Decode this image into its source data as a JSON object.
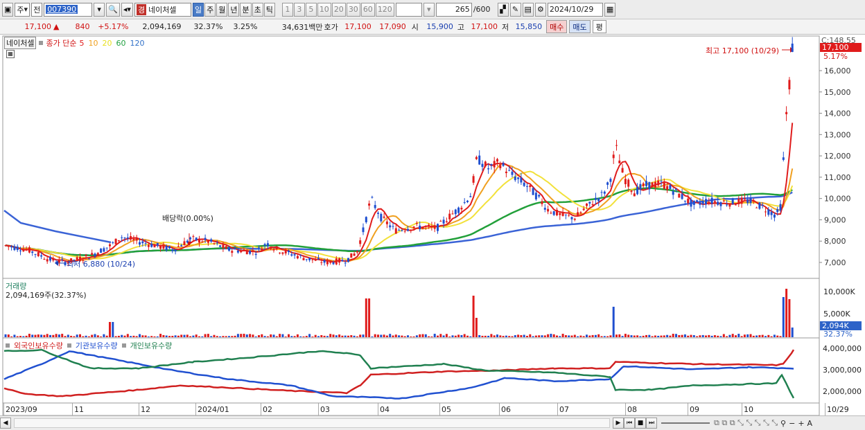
{
  "toolbar": {
    "market": "주",
    "type": "전",
    "code": "007390",
    "name_badge": "경",
    "name": "네이처셀",
    "periods": [
      "일",
      "주",
      "월",
      "년",
      "분",
      "초",
      "틱"
    ],
    "selected_period": "일",
    "intervals": [
      "1",
      "3",
      "5",
      "10",
      "20",
      "30",
      "60",
      "120"
    ],
    "count": "265",
    "count_max": "/600",
    "date": "2024/10/29"
  },
  "quote": {
    "price": "17,100",
    "arrow": "▲",
    "change": "840",
    "change_pct": "+5.17%",
    "volume": "2,094,169",
    "turnover": "32.37%",
    "ratio": "3.25%",
    "amount": "34,631백만",
    "bid_label": "호가",
    "ask": "17,100",
    "bid": "17,090",
    "open_label": "시",
    "open": "15,900",
    "high_label": "고",
    "high": "17,100",
    "low_label": "저",
    "low": "15,850",
    "buy_label": "매수",
    "sell_label": "매도",
    "eval_label": "평"
  },
  "legend": {
    "title": "네이처셀",
    "ma_label": "종가 단순",
    "ma_periods": [
      "5",
      "10",
      "20",
      "60",
      "120"
    ],
    "ma_colors": [
      "#e01c1c",
      "#f0a020",
      "#e8e020",
      "#20a040",
      "#3070c8"
    ]
  },
  "annotations": {
    "high": "최고 17,100 (10/29)",
    "low": "최저 6,880 (10/24)",
    "dividend": "배당락(0.00%)",
    "right_top": "C:148.55",
    "right_price": "17,100",
    "right_pct": "5.17%"
  },
  "volume_panel": {
    "title": "거래량",
    "value": "2,094,169주(32.37%)",
    "ticks": [
      "10,000K",
      "5,000K"
    ],
    "current": "2,094K",
    "current_pct": "32.37%"
  },
  "holding_panel": {
    "titles": [
      "외국인보유수량",
      "기관보유수량",
      "개인보유수량"
    ],
    "title_colors": [
      "#d02020",
      "#2050d0",
      "#208050"
    ],
    "ticks": [
      "4,000,000",
      "3,000,000",
      "2,000,000"
    ]
  },
  "chart_data": {
    "type": "candlestick",
    "x_axis_labels": [
      "2023/09",
      "11",
      "12",
      "2024/01",
      "02",
      "03",
      "04",
      "05",
      "06",
      "07",
      "08",
      "09",
      "10",
      "10/29"
    ],
    "y_axis_ticks": [
      "16,000",
      "15,000",
      "14,000",
      "13,000",
      "12,000",
      "11,000",
      "10,000",
      "9,000",
      "8,000",
      "7,000"
    ],
    "close_approx": [
      {
        "date": "2023/09",
        "close": 7800
      },
      {
        "date": "2023/10",
        "close": 7100
      },
      {
        "date": "2023/11",
        "close": 8100
      },
      {
        "date": "2023/12",
        "close": 7800
      },
      {
        "date": "2024/01",
        "close": 8100
      },
      {
        "date": "2024/02",
        "close": 7600
      },
      {
        "date": "2024/03",
        "close": 7000
      },
      {
        "date": "2024/04",
        "close": 8600
      },
      {
        "date": "2024/05",
        "close": 8900
      },
      {
        "date": "2024/06",
        "close": 11500
      },
      {
        "date": "2024/07",
        "close": 9200
      },
      {
        "date": "2024/08",
        "close": 10600
      },
      {
        "date": "2024/09",
        "close": 9800
      },
      {
        "date": "2024/10",
        "close": 9300
      },
      {
        "date": "2024/10/29",
        "close": 17100
      }
    ]
  },
  "bottom_bar": {
    "nav": [
      "◀",
      "▶",
      "⏮",
      "■",
      "⏭"
    ],
    "zoom": [
      "−",
      "+",
      "A"
    ]
  }
}
